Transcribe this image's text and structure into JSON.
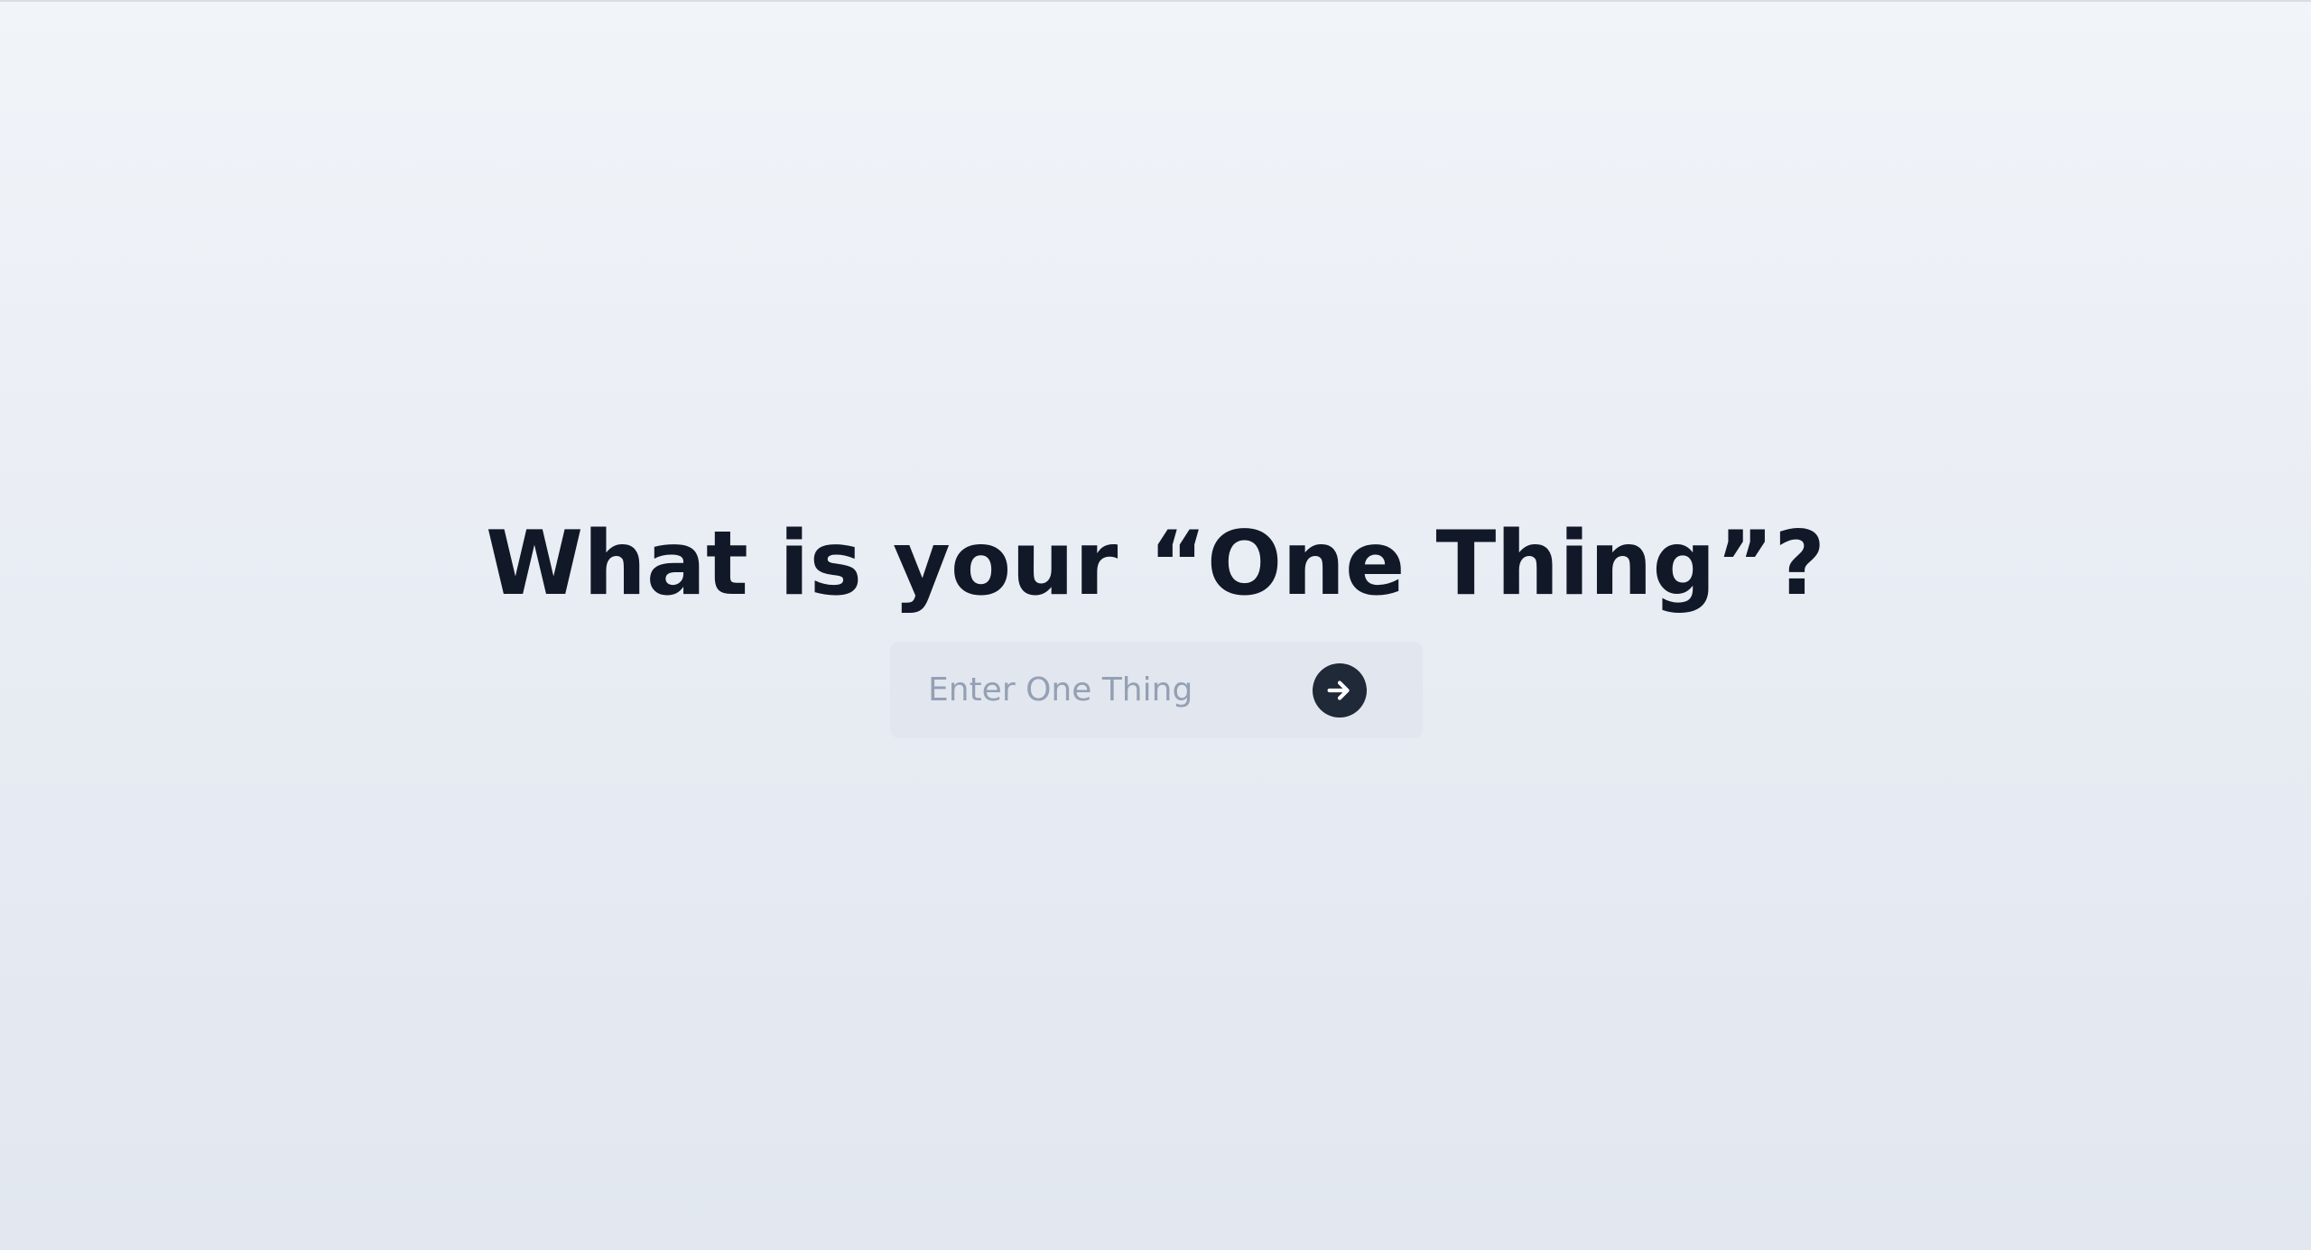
{
  "main": {
    "heading": "What is your “One Thing”?",
    "input": {
      "placeholder": "Enter One Thing",
      "value": ""
    },
    "submit": {
      "icon": "arrow-right-icon"
    }
  },
  "colors": {
    "heading": "#111827",
    "input_background": "#e2e7ef",
    "button_background": "#1f2937",
    "placeholder": "#94a0b4"
  }
}
